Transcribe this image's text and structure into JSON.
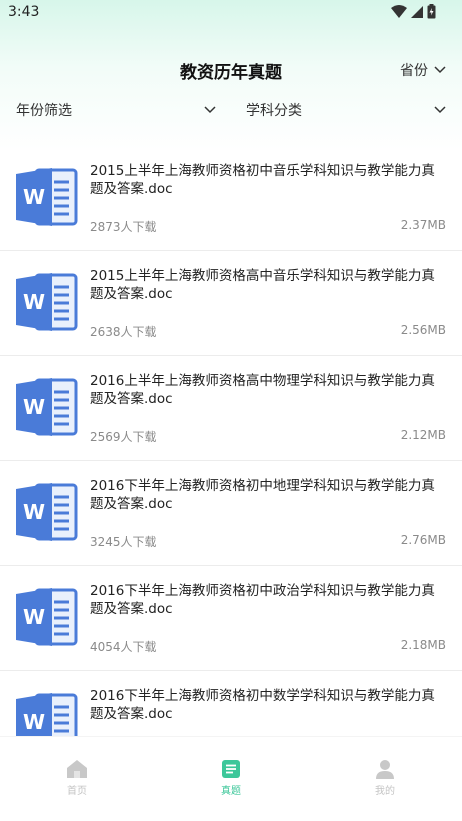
{
  "status_bar": {
    "time": "3:43"
  },
  "header": {
    "title": "教资历年真题",
    "province_label": "省份"
  },
  "filters": {
    "year_label": "年份筛选",
    "subject_label": "学科分类"
  },
  "doc_icon_letter": "W",
  "items": [
    {
      "title": "2015上半年上海教师资格初中音乐学科知识与教学能力真题及答案.doc",
      "downloads": "2873人下载",
      "size": "2.37MB"
    },
    {
      "title": "2015上半年上海教师资格高中音乐学科知识与教学能力真题及答案.doc",
      "downloads": "2638人下载",
      "size": "2.56MB"
    },
    {
      "title": "2016上半年上海教师资格高中物理学科知识与教学能力真题及答案.doc",
      "downloads": "2569人下载",
      "size": "2.12MB"
    },
    {
      "title": "2016下半年上海教师资格初中地理学科知识与教学能力真题及答案.doc",
      "downloads": "3245人下载",
      "size": "2.76MB"
    },
    {
      "title": "2016下半年上海教师资格初中政治学科知识与教学能力真题及答案.doc",
      "downloads": "4054人下载",
      "size": "2.18MB"
    },
    {
      "title": "2016下半年上海教师资格初中数学学科知识与教学能力真题及答案.doc",
      "downloads": "",
      "size": ""
    }
  ],
  "tabs": [
    {
      "label": "首页",
      "icon": "home-icon"
    },
    {
      "label": "真题",
      "icon": "document-icon"
    },
    {
      "label": "我的",
      "icon": "user-icon"
    }
  ],
  "colors": {
    "accent": "#3cc79a",
    "word_blue": "#4a7bd8",
    "muted": "#c4c4c4"
  }
}
